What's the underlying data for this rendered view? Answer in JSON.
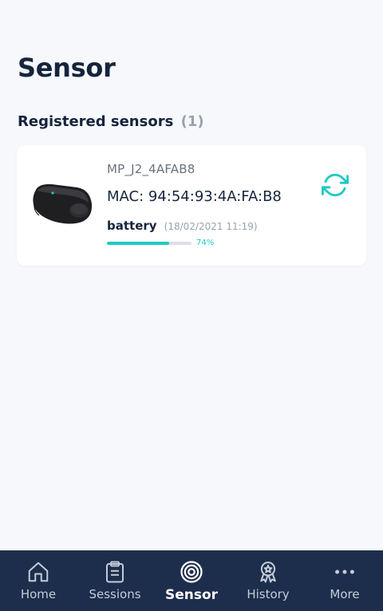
{
  "page": {
    "title": "Sensor"
  },
  "registered": {
    "heading": "Registered sensors",
    "count": "(1)"
  },
  "sensor": {
    "name": "MP_J2_4AFAB8",
    "mac": "MAC: 94:54:93:4A:FA:B8",
    "battery_label": "battery",
    "battery_date": "(18/02/2021 11:19)",
    "battery_percent": 74,
    "battery_percent_text": "74%",
    "refresh_icon": "refresh-icon"
  },
  "colors": {
    "accent": "#1fc9c2",
    "navbar": "#1d2e4c",
    "title": "#16243d",
    "background": "#f6f8fb"
  },
  "tabs": [
    {
      "label": "Home",
      "icon": "home-icon",
      "active": false
    },
    {
      "label": "Sessions",
      "icon": "clipboard-icon",
      "active": false
    },
    {
      "label": "Sensor",
      "icon": "target-icon",
      "active": true
    },
    {
      "label": "History",
      "icon": "award-icon",
      "active": false
    },
    {
      "label": "More",
      "icon": "more-icon",
      "active": false
    }
  ]
}
